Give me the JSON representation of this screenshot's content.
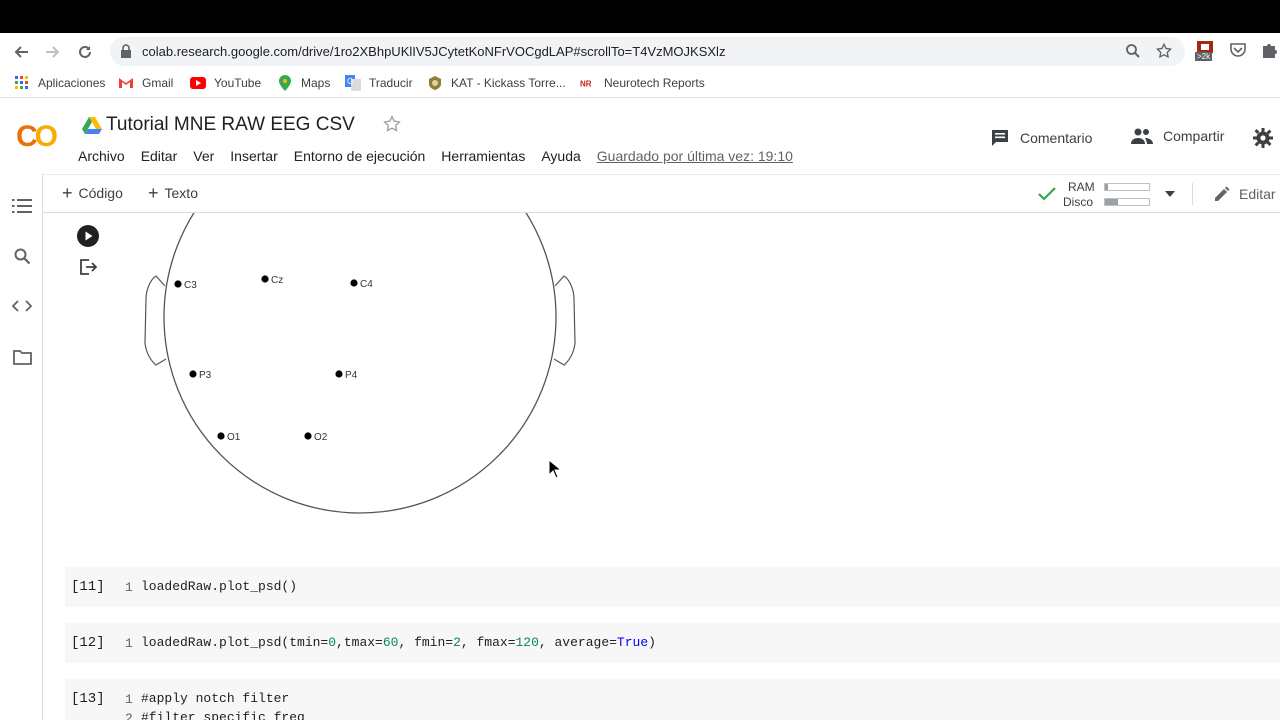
{
  "browser": {
    "url": "colab.research.google.com/drive/1ro2XBhpUKlIV5JCytetKoNFrVOCgdLAP#scrollTo=T4VzMOJKSXlz",
    "extension_badge": ">2k"
  },
  "bookmarks": [
    {
      "label": "Aplicaciones",
      "icon": "apps-grid-icon"
    },
    {
      "label": "Gmail",
      "icon": "gmail-icon"
    },
    {
      "label": "YouTube",
      "icon": "youtube-icon"
    },
    {
      "label": "Maps",
      "icon": "maps-icon"
    },
    {
      "label": "Traducir",
      "icon": "translate-icon"
    },
    {
      "label": "KAT - Kickass Torre...",
      "icon": "kat-icon"
    },
    {
      "label": "Neurotech Reports",
      "icon": "neurotech-icon"
    }
  ],
  "colab": {
    "logo": "CO",
    "title": "Tutorial MNE RAW EEG CSV",
    "menu": [
      "Archivo",
      "Editar",
      "Ver",
      "Insertar",
      "Entorno de ejecución",
      "Herramientas",
      "Ayuda"
    ],
    "saved": "Guardado por última vez: 19:10",
    "comment": "Comentario",
    "share": "Compartir"
  },
  "toolbar": {
    "add_code": "Código",
    "add_text": "Texto",
    "ram_label": "RAM",
    "disk_label": "Disco",
    "edit": "Editar"
  },
  "topomap": {
    "electrodes": [
      "C3",
      "Cz",
      "C4",
      "P3",
      "P4",
      "O1",
      "O2"
    ]
  },
  "cells": [
    {
      "number": "[11]",
      "line": "1",
      "code": "loadedRaw.plot_psd()"
    },
    {
      "number": "[12]",
      "line": "1",
      "code_parts": [
        "loadedRaw.plot_psd(tmin=",
        "0",
        ",tmax=",
        "60",
        ", fmin=",
        "2",
        ", fmax=",
        "120",
        ", average=",
        "True",
        ")"
      ]
    },
    {
      "number": "[13]",
      "line": "1",
      "code": "#apply notch filter",
      "line2": "2",
      "code2": "#filter specific freq"
    }
  ],
  "colors": {
    "logo_orange": "#F9AB00",
    "logo_dark_orange": "#E8710A",
    "accent_green": "#34a853"
  }
}
